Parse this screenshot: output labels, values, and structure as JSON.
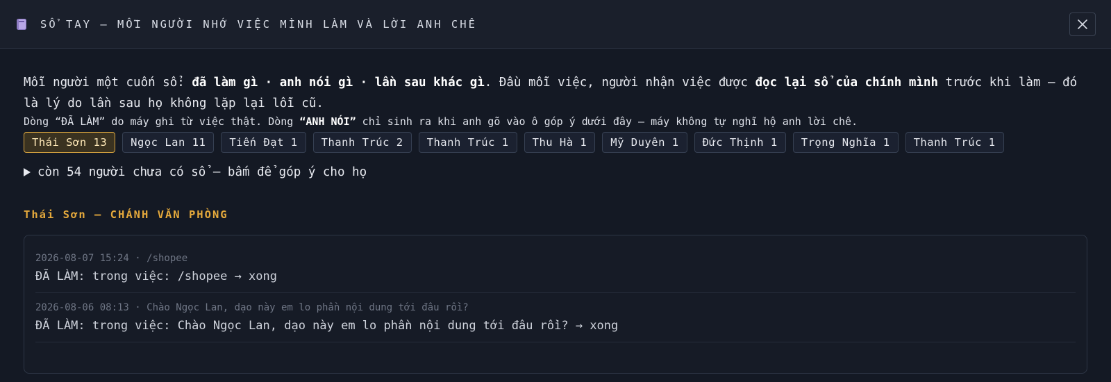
{
  "header": {
    "icon": "notebook-icon",
    "title": "SỔ TAY — MỖI NGƯỜI NHỚ VIỆC MÌNH LÀM VÀ LỜI ANH CHÊ",
    "close_icon": "close-icon"
  },
  "intro": {
    "p1_a": "Mỗi người một cuốn sổ: ",
    "p1_b": "đã làm gì · anh nói gì · lần sau khác gì",
    "p1_c": ". Đầu mỗi việc, người nhận việc được ",
    "p1_d": "đọc lại sổ của chính mình",
    "p1_e": " trước khi làm — đó là lý do lần sau họ không lặp lại lỗi cũ.",
    "p2_a": "Dòng “ĐÃ LÀM” do máy ghi từ việc thật. Dòng ",
    "p2_b": "“ANH NÓI”",
    "p2_c": " chỉ sinh ra khi anh gõ vào ô góp ý dưới đây — máy không tự nghĩ hộ anh lời chê."
  },
  "chips": [
    {
      "label": "Thái Sơn 13",
      "active": true
    },
    {
      "label": "Ngọc Lan 11",
      "active": false
    },
    {
      "label": "Tiến Đạt 1",
      "active": false
    },
    {
      "label": "Thanh Trúc 2",
      "active": false
    },
    {
      "label": "Thanh Trúc 1",
      "active": false
    },
    {
      "label": "Thu Hà 1",
      "active": false
    },
    {
      "label": "Mỹ Duyên 1",
      "active": false
    },
    {
      "label": "Đức Thịnh 1",
      "active": false
    },
    {
      "label": "Trọng Nghĩa 1",
      "active": false
    },
    {
      "label": "Thanh Trúc 1",
      "active": false
    }
  ],
  "expander": {
    "icon": "triangle-right-icon",
    "label": "còn 54 người chưa có sổ — bấm để góp ý cho họ"
  },
  "person": {
    "heading": "Thái Sơn — CHÁNH VĂN PHÒNG"
  },
  "entries": [
    {
      "meta": "2026-08-07 15:24 · /shopee",
      "did": "ĐÃ LÀM: trong việc: /shopee → xong"
    },
    {
      "meta": "2026-08-06 08:13 · Chào Ngọc Lan, dạo này em lo phần nội dung tới đâu rồi?",
      "did": "ĐÃ LÀM: trong việc: Chào Ngọc Lan, dạo này em lo phần nội dung tới đâu rồi? → xong"
    }
  ],
  "colors": {
    "accent": "#e5a93c",
    "background": "#141924",
    "active_chip_border": "#d9a640"
  }
}
